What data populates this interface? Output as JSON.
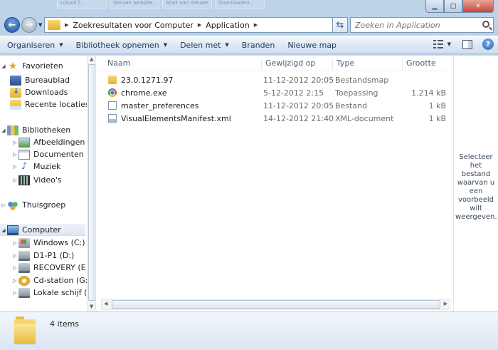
{
  "titlebar": {
    "ghost_tabs": [
      "Lokaal f...",
      "Nieuwe website...",
      "Start van nieuwe...",
      "Downloaden..."
    ],
    "controls": [
      "minimize-icon",
      "maximize-icon",
      "close-icon"
    ]
  },
  "address": {
    "crumbs": [
      "Zoekresultaten voor Computer",
      "Application"
    ],
    "search_placeholder": "Zoeken in Application"
  },
  "toolbar": {
    "organize": "Organiseren",
    "include_library": "Bibliotheek opnemen",
    "share_with": "Delen met",
    "burn": "Branden",
    "new_folder": "Nieuwe map"
  },
  "sidebar": {
    "favorites": {
      "label": "Favorieten",
      "items": [
        "Bureaublad",
        "Downloads",
        "Recente locaties"
      ]
    },
    "libraries": {
      "label": "Bibliotheken",
      "items": [
        "Afbeeldingen",
        "Documenten",
        "Muziek",
        "Video's"
      ]
    },
    "homegroup": {
      "label": "Thuisgroep"
    },
    "computer": {
      "label": "Computer",
      "items": [
        "Windows (C:)",
        "D1-P1 (D:)",
        "RECOVERY (E:)",
        "Cd-station (G:)",
        "Lokale schijf (Q:)"
      ]
    }
  },
  "filelist": {
    "columns": {
      "name": "Naam",
      "modified": "Gewijzigd op",
      "type": "Type",
      "size": "Grootte"
    },
    "rows": [
      {
        "name": "23.0.1271.97",
        "modified": "11-12-2012 20:05",
        "type": "Bestandsmap",
        "size": "",
        "icon": "folder-icon"
      },
      {
        "name": "chrome.exe",
        "modified": "5-12-2012 2:15",
        "type": "Toepassing",
        "size": "1.214 kB",
        "icon": "chrome-icon"
      },
      {
        "name": "master_preferences",
        "modified": "11-12-2012 20:05",
        "type": "Bestand",
        "size": "1 kB",
        "icon": "file-icon"
      },
      {
        "name": "VisualElementsManifest.xml",
        "modified": "14-12-2012 21:40",
        "type": "XML-document",
        "size": "1 kB",
        "icon": "xml-file-icon"
      }
    ]
  },
  "preview": {
    "text": "Selecteer het bestand waarvan u een voorbeeld wilt weergeven."
  },
  "details": {
    "item_count": "4 items"
  },
  "colors": {
    "accent": "#1e395b",
    "window_chrome": "#bcd3e8",
    "folder": "#e2b234"
  }
}
